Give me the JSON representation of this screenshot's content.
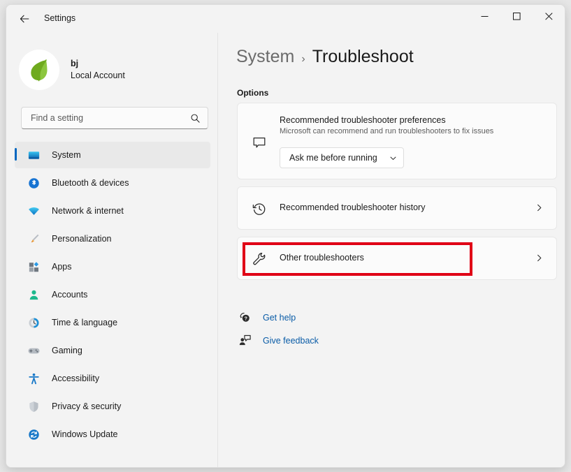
{
  "window": {
    "app_title": "Settings",
    "back_icon": "back-arrow-icon",
    "controls": {
      "minimize": "–",
      "maximize": "□",
      "close": "✕"
    }
  },
  "account": {
    "name": "bj",
    "type": "Local Account",
    "avatar_icon": "leaf-avatar-icon"
  },
  "search": {
    "placeholder": "Find a setting",
    "value": "",
    "icon": "search-icon"
  },
  "sidebar": {
    "items": [
      {
        "label": "System",
        "icon": "monitor-icon",
        "selected": true
      },
      {
        "label": "Bluetooth & devices",
        "icon": "bluetooth-icon",
        "selected": false
      },
      {
        "label": "Network & internet",
        "icon": "wifi-icon",
        "selected": false
      },
      {
        "label": "Personalization",
        "icon": "paintbrush-icon",
        "selected": false
      },
      {
        "label": "Apps",
        "icon": "apps-icon",
        "selected": false
      },
      {
        "label": "Accounts",
        "icon": "person-icon",
        "selected": false
      },
      {
        "label": "Time & language",
        "icon": "clock-globe-icon",
        "selected": false
      },
      {
        "label": "Gaming",
        "icon": "gamepad-icon",
        "selected": false
      },
      {
        "label": "Accessibility",
        "icon": "accessibility-icon",
        "selected": false
      },
      {
        "label": "Privacy & security",
        "icon": "shield-icon",
        "selected": false
      },
      {
        "label": "Windows Update",
        "icon": "update-icon",
        "selected": false
      }
    ]
  },
  "main": {
    "breadcrumb": {
      "parent": "System",
      "separator": "›",
      "current": "Troubleshoot"
    },
    "section_label": "Options",
    "cards": {
      "preferences": {
        "icon": "speech-bubble-icon",
        "title": "Recommended troubleshooter preferences",
        "subtitle": "Microsoft can recommend and run troubleshooters to fix issues",
        "dropdown": {
          "selected": "Ask me before running",
          "chevron_icon": "chevron-down-icon"
        }
      },
      "history": {
        "icon": "history-clock-icon",
        "title": "Recommended troubleshooter history",
        "chevron_icon": "chevron-right-icon"
      },
      "other": {
        "icon": "wrench-icon",
        "title": "Other troubleshooters",
        "chevron_icon": "chevron-right-icon",
        "highlighted": true,
        "highlight_color": "#e00016"
      }
    },
    "links": [
      {
        "label": "Get help",
        "icon": "help-question-icon"
      },
      {
        "label": "Give feedback",
        "icon": "feedback-person-icon"
      }
    ]
  }
}
